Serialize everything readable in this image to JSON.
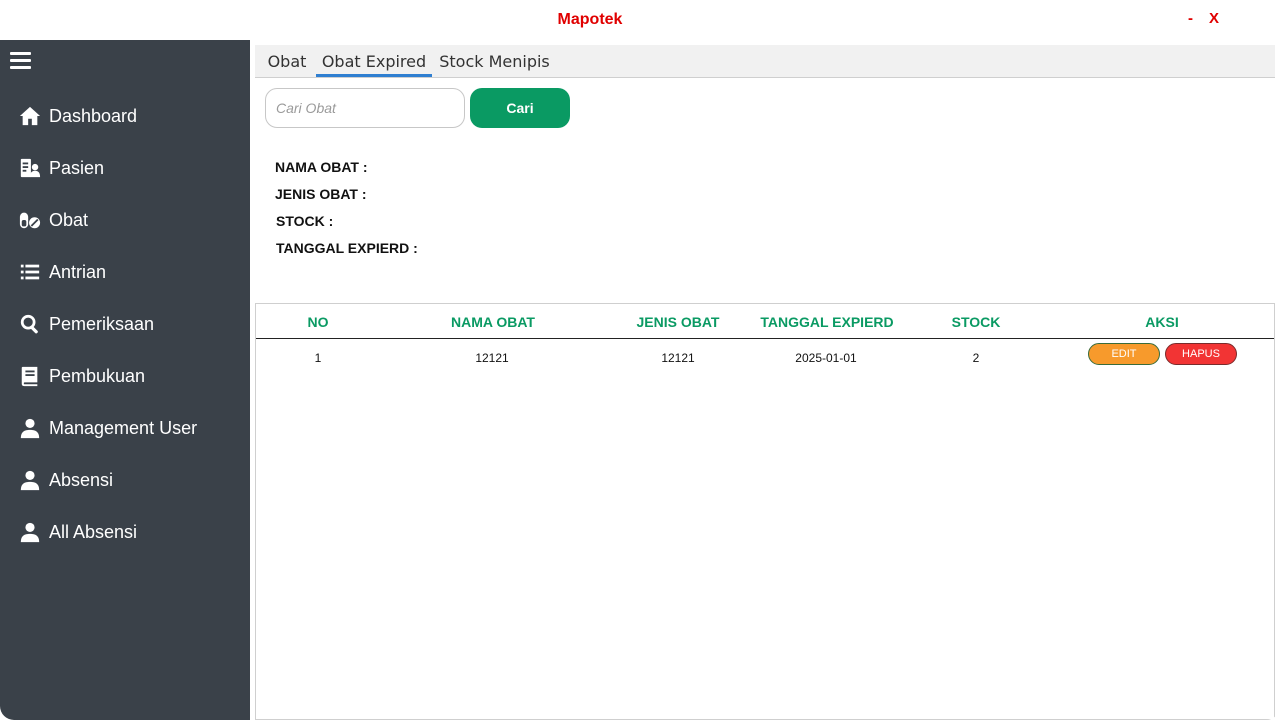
{
  "window": {
    "title": "Mapotek",
    "minimize_label": "-",
    "close_label": "X",
    "title_color": "#e00000"
  },
  "sidebar": {
    "background": "#3a4149",
    "items": [
      {
        "label": "Dashboard",
        "icon": "home-icon"
      },
      {
        "label": "Pasien",
        "icon": "patient-icon"
      },
      {
        "label": "Obat",
        "icon": "pills-icon"
      },
      {
        "label": "Antrian",
        "icon": "list-icon"
      },
      {
        "label": "Pemeriksaan",
        "icon": "search-icon"
      },
      {
        "label": "Pembukuan",
        "icon": "book-icon"
      },
      {
        "label": "Management User",
        "icon": "user-icon"
      },
      {
        "label": "Absensi",
        "icon": "user-icon"
      },
      {
        "label": "All Absensi",
        "icon": "user-icon"
      }
    ]
  },
  "tabs": [
    {
      "label": "Obat",
      "active": false
    },
    {
      "label": "Obat Expired",
      "active": true
    },
    {
      "label": "Stock Menipis",
      "active": false
    }
  ],
  "search": {
    "placeholder": "Cari Obat",
    "button_label": "Cari",
    "button_color": "#0a9a63"
  },
  "details": {
    "nama_label": "NAMA OBAT :",
    "jenis_label": "JENIS OBAT :",
    "stock_label": "STOCK :",
    "tanggal_label": "TANGGAL EXPIERD :"
  },
  "table": {
    "header_color": "#0a9a63",
    "columns": [
      "NO",
      "NAMA OBAT",
      "JENIS OBAT",
      "TANGGAL EXPIERD",
      "STOCK",
      "AKSI"
    ],
    "rows": [
      {
        "no": "1",
        "nama": "12121",
        "jenis": "12121",
        "tanggal": "2025-01-01",
        "stock": "2",
        "edit_label": "EDIT",
        "delete_label": "HAPUS"
      }
    ]
  }
}
